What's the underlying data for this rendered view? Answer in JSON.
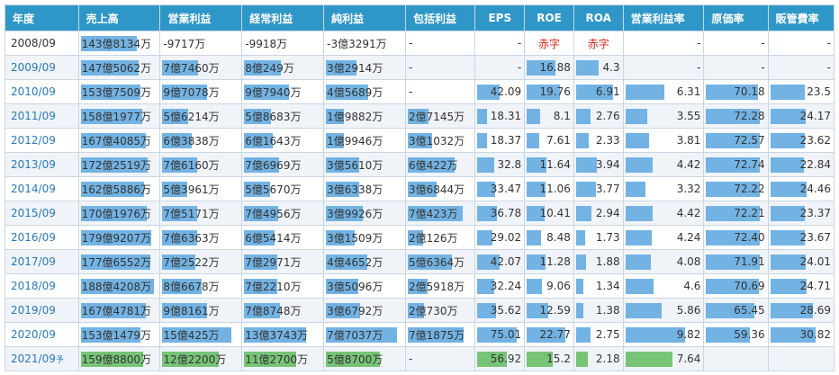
{
  "colors": {
    "header_bg": "#2f97c7",
    "bar_blue": "#73b3e3",
    "bar_green": "#77c477",
    "link": "#2a7ab8",
    "deficit_red": "#d2231b"
  },
  "headers": [
    "年度",
    "売上高",
    "営業利益",
    "経常利益",
    "純利益",
    "包括利益",
    "EPS",
    "ROE",
    "ROA",
    "営業利益率",
    "原価率",
    "販管費率"
  ],
  "rows": [
    {
      "year": "2008/09",
      "forecast": "",
      "cells": [
        "143億8134万",
        "-9717万",
        "-9918万",
        "-3億3291万",
        "-",
        "-",
        "赤字",
        "赤字",
        "-",
        "-",
        "-"
      ]
    },
    {
      "year": "2009/09",
      "forecast": "",
      "cells": [
        "147億5062万",
        "7億7460万",
        "8億249万",
        "3億2914万",
        "-",
        "-",
        "16.88",
        "4.3",
        "-",
        "-",
        "-"
      ]
    },
    {
      "year": "2010/09",
      "forecast": "",
      "cells": [
        "153億7509万",
        "9億7078万",
        "9億7940万",
        "4億5689万",
        "-",
        "42.09",
        "19.76",
        "6.91",
        "6.31",
        "70.18",
        "23.5"
      ]
    },
    {
      "year": "2011/09",
      "forecast": "",
      "cells": [
        "158億1977万",
        "5億6214万",
        "5億8683万",
        "1億9882万",
        "2億7145万",
        "18.31",
        "8.1",
        "2.76",
        "3.55",
        "72.28",
        "24.17"
      ]
    },
    {
      "year": "2012/09",
      "forecast": "",
      "cells": [
        "167億4085万",
        "6億3838万",
        "6億1643万",
        "1億9946万",
        "3億1032万",
        "18.37",
        "7.61",
        "2.33",
        "3.81",
        "72.57",
        "23.62"
      ]
    },
    {
      "year": "2013/09",
      "forecast": "",
      "cells": [
        "172億2519万",
        "7億6160万",
        "7億6969万",
        "3億5610万",
        "6億422万",
        "32.8",
        "11.64",
        "3.94",
        "4.42",
        "72.74",
        "22.84"
      ]
    },
    {
      "year": "2014/09",
      "forecast": "",
      "cells": [
        "162億5886万",
        "5億3961万",
        "5億5670万",
        "3億6338万",
        "3億6844万",
        "33.47",
        "11.06",
        "3.77",
        "3.32",
        "72.22",
        "24.46"
      ]
    },
    {
      "year": "2015/09",
      "forecast": "",
      "cells": [
        "170億1976万",
        "7億5171万",
        "7億4956万",
        "3億9926万",
        "7億423万",
        "36.78",
        "10.41",
        "2.94",
        "4.42",
        "72.21",
        "23.37"
      ]
    },
    {
      "year": "2016/09",
      "forecast": "",
      "cells": [
        "179億9207万",
        "7億6363万",
        "6億5414万",
        "3億1509万",
        "2億126万",
        "29.02",
        "8.48",
        "1.73",
        "4.24",
        "72.40",
        "23.67"
      ]
    },
    {
      "year": "2017/09",
      "forecast": "",
      "cells": [
        "177億6552万",
        "7億2522万",
        "7億2971万",
        "4億4652万",
        "5億6364万",
        "42.07",
        "11.28",
        "1.88",
        "4.08",
        "71.91",
        "24.01"
      ]
    },
    {
      "year": "2018/09",
      "forecast": "",
      "cells": [
        "188億4208万",
        "8億6678万",
        "7億2210万",
        "3億5096万",
        "2億5918万",
        "32.24",
        "9.06",
        "1.34",
        "4.6",
        "70.69",
        "24.71"
      ]
    },
    {
      "year": "2019/09",
      "forecast": "",
      "cells": [
        "167億4781万",
        "9億8161万",
        "7億8748万",
        "3億6792万",
        "2億730万",
        "35.62",
        "12.59",
        "1.38",
        "5.86",
        "65.45",
        "28.69"
      ]
    },
    {
      "year": "2020/09",
      "forecast": "",
      "cells": [
        "153億1479万",
        "15億425万",
        "13億3743万",
        "7億7037万",
        "7億1875万",
        "75.01",
        "22.77",
        "2.75",
        "9.82",
        "59.36",
        "30.82"
      ]
    },
    {
      "year": "2021/09",
      "forecast": "予",
      "cells": [
        "159億8800万",
        "12億2200万",
        "11億2700万",
        "5億8700万",
        "-",
        "56.92",
        "15.2",
        "2.18",
        "7.64",
        "",
        ""
      ]
    }
  ]
}
